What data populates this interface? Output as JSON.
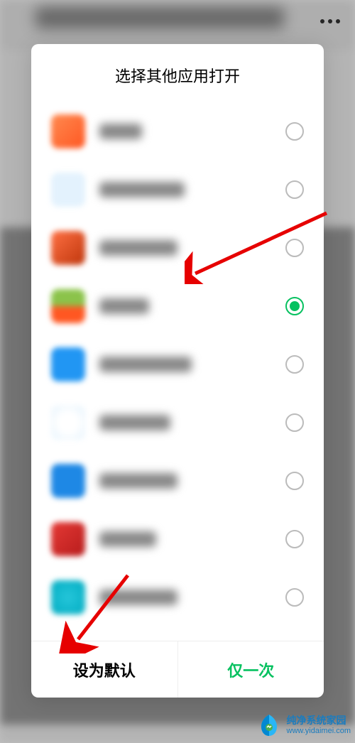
{
  "modal": {
    "title": "选择其他应用打开",
    "apps": [
      {
        "selected": false
      },
      {
        "selected": false
      },
      {
        "selected": false
      },
      {
        "selected": true
      },
      {
        "selected": false
      },
      {
        "selected": false
      },
      {
        "selected": false
      },
      {
        "selected": false
      },
      {
        "selected": false
      }
    ],
    "actions": {
      "set_default": "设为默认",
      "just_once": "仅一次"
    }
  },
  "watermark": {
    "name": "纯净系统家园",
    "url": "www.yidaimei.com"
  }
}
